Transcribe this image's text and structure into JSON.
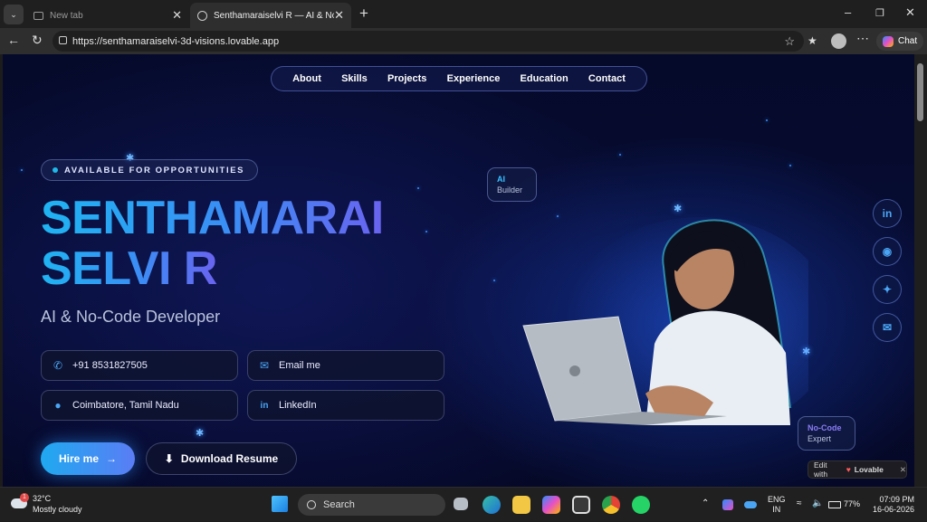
{
  "browser": {
    "tabs": [
      {
        "label": "New tab",
        "active": false
      },
      {
        "label": "Senthamaraiselvi R — AI & No-Co",
        "active": true
      }
    ],
    "url": "https://senthamaraiselvi-3d-visions.lovable.app",
    "chat_label": "Chat"
  },
  "nav": {
    "items": [
      "About",
      "Skills",
      "Projects",
      "Experience",
      "Education",
      "Contact"
    ]
  },
  "hero": {
    "badge": "AVAILABLE FOR OPPORTUNITIES",
    "name_line1": "SENTHAMARAI",
    "name_line2": "SELVI R",
    "role": "AI & No-Code Developer",
    "contacts": {
      "phone": "+91 8531827505",
      "email": "Email me",
      "location": "Coimbatore, Tamil Nadu",
      "linkedin": "LinkedIn"
    },
    "hire_label": "Hire me",
    "download_label": "Download Resume"
  },
  "chips": {
    "ai_title": "AI",
    "ai_sub": "Builder",
    "nocode_title": "No-Code",
    "nocode_sub": "Expert"
  },
  "social": [
    "linkedin-icon",
    "github-icon",
    "twitter-icon",
    "mail-icon"
  ],
  "lovable": {
    "prefix": "Edit with",
    "brand": "Lovable"
  },
  "taskbar": {
    "weather_temp": "32°C",
    "weather_desc": "Mostly cloudy",
    "weather_badge": "1",
    "search_label": "Search",
    "lang1": "ENG",
    "lang2": "IN",
    "battery": "77%",
    "time": "07:09 PM",
    "date": "16-06-2026"
  },
  "colors": {
    "accent": "#1fb4f2",
    "accent2": "#6a63f0",
    "page_bg": "#060b2e"
  }
}
